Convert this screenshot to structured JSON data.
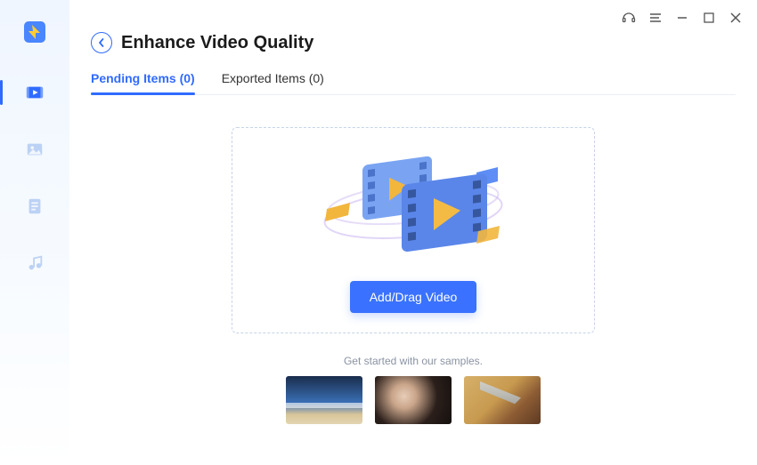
{
  "header": {
    "title": "Enhance Video Quality"
  },
  "tabs": {
    "pending": {
      "label": "Pending Items (0)"
    },
    "exported": {
      "label": "Exported Items (0)"
    }
  },
  "dropzone": {
    "button_label": "Add/Drag Video"
  },
  "samples": {
    "caption": "Get started with our samples."
  },
  "sidebar": {
    "items": [
      {
        "name": "video",
        "active": true
      },
      {
        "name": "image",
        "active": false
      },
      {
        "name": "document",
        "active": false
      },
      {
        "name": "audio",
        "active": false
      }
    ]
  },
  "icons": {
    "logo": "app-logo",
    "back": "chevron-left",
    "headset": "support-headset",
    "menu": "menu-lines",
    "minimize": "window-minimize",
    "maximize": "window-maximize",
    "close": "window-close"
  }
}
